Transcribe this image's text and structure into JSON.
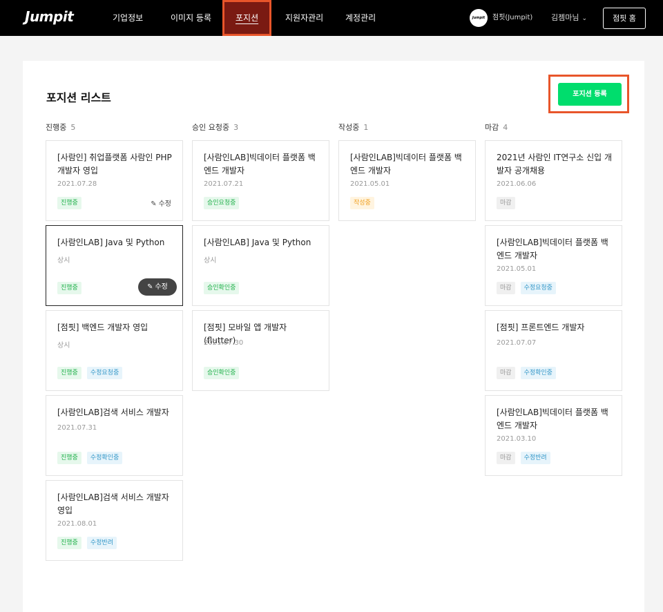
{
  "nav": {
    "logo": "Jumpit",
    "items": [
      "기업정보",
      "이미지 등록",
      "포지션",
      "지원자관리",
      "계정관리"
    ],
    "company_avatar": "Jumpit",
    "company_name": "점핏(Jumpit)",
    "user_name": "김젬마님",
    "home_label": "점핏 홈"
  },
  "page": {
    "title": "포지션 리스트",
    "register_label": "포지션 등록"
  },
  "columns": [
    {
      "label": "진행중",
      "count": "5",
      "cards": [
        {
          "title": "[사람인] 취업플랫폼 사람인 PHP 개발자 영입",
          "date": "2021.07.28",
          "tags": [
            "진행중"
          ],
          "edit": "수정"
        },
        {
          "title": "[사람인LAB] Java 및 Python",
          "date": "상시",
          "tags": [
            "진행중"
          ],
          "edit": "수정"
        },
        {
          "title": "[점핏] 백엔드 개발자 영입",
          "date": "상시",
          "tags": [
            "진행중",
            "수정요청중"
          ]
        },
        {
          "title": "[사람인LAB]검색 서비스 개발자",
          "date": "2021.07.31",
          "tags": [
            "진행중",
            "수정확인중"
          ]
        },
        {
          "title": "[사람인LAB]검색 서비스 개발자 영입",
          "date": "2021.08.01",
          "tags": [
            "진행중",
            "수정반려"
          ]
        }
      ]
    },
    {
      "label": "승인 요청중",
      "count": "3",
      "cards": [
        {
          "title": "[사람인LAB]빅데이터 플랫폼 백엔드 개발자",
          "date": "2021.07.21",
          "tags": [
            "승인요청중"
          ]
        },
        {
          "title": "[사람인LAB] Java 및 Python",
          "date": "상시",
          "tags": [
            "승인확인중"
          ]
        },
        {
          "title": "[점핏] 모바일 앱 개발자 (flutter)",
          "date": "2021.07.30",
          "tags": [
            "승인확인중"
          ]
        }
      ]
    },
    {
      "label": "작성중",
      "count": "1",
      "cards": [
        {
          "title": "[사람인LAB]빅데이터 플랫폼 백엔드 개발자",
          "date": "2021.05.01",
          "tags": [
            "작성중"
          ]
        }
      ]
    },
    {
      "label": "마감",
      "count": "4",
      "cards": [
        {
          "title": "2021년 사람인 IT연구소 신입 개발자 공개채용",
          "date": "2021.06.06",
          "tags": [
            "마감"
          ]
        },
        {
          "title": "[사람인LAB]빅데이터 플랫폼 백엔드 개발자",
          "date": "2021.05.01",
          "tags": [
            "마감",
            "수정요청중"
          ]
        },
        {
          "title": "[점핏] 프론트엔드 개발자",
          "date": "2021.07.07",
          "tags": [
            "마감",
            "수정확인중"
          ]
        },
        {
          "title": "[사람인LAB]빅데이터 플랫폼 백엔드 개발자",
          "date": "2021.03.10",
          "tags": [
            "마감",
            "수정반려"
          ]
        }
      ]
    }
  ],
  "colors": {
    "accent_green": "#00dd6d",
    "highlight_orange": "#e8552a"
  }
}
